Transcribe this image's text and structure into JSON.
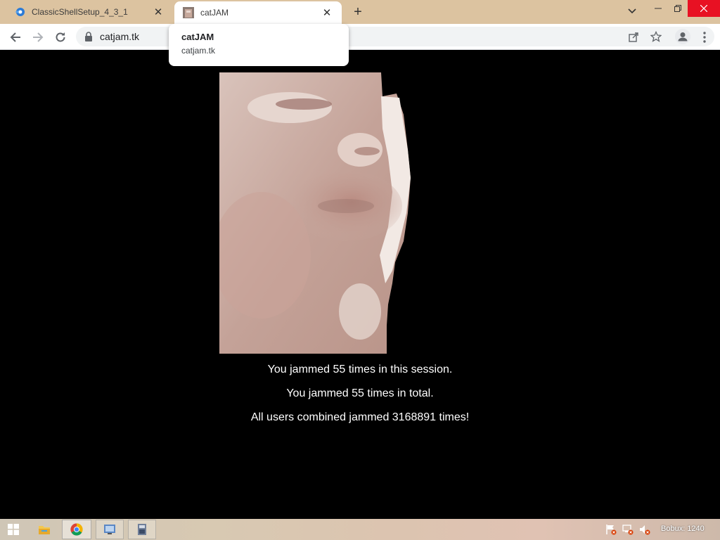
{
  "browser": {
    "tabs": [
      {
        "title": "ClassicShellSetup_4_3_1",
        "active": false
      },
      {
        "title": "catJAM",
        "active": true
      }
    ],
    "url": "catjam.tk",
    "hover_card": {
      "title": "catJAM",
      "domain": "catjam.tk"
    }
  },
  "page": {
    "stats": [
      "You jammed 55 times in this session.",
      "You jammed 55 times in total.",
      "All users combined jammed 3168891 times!"
    ]
  },
  "taskbar": {
    "clock": "Bobux: 1240",
    "apps": [
      "start-icon",
      "file-explorer-icon",
      "chrome-icon",
      "app-window-icon",
      "installer-icon"
    ]
  },
  "colors": {
    "tabstrip": "#dcc3a0",
    "close_button": "#e81123",
    "page_background": "#000000"
  }
}
